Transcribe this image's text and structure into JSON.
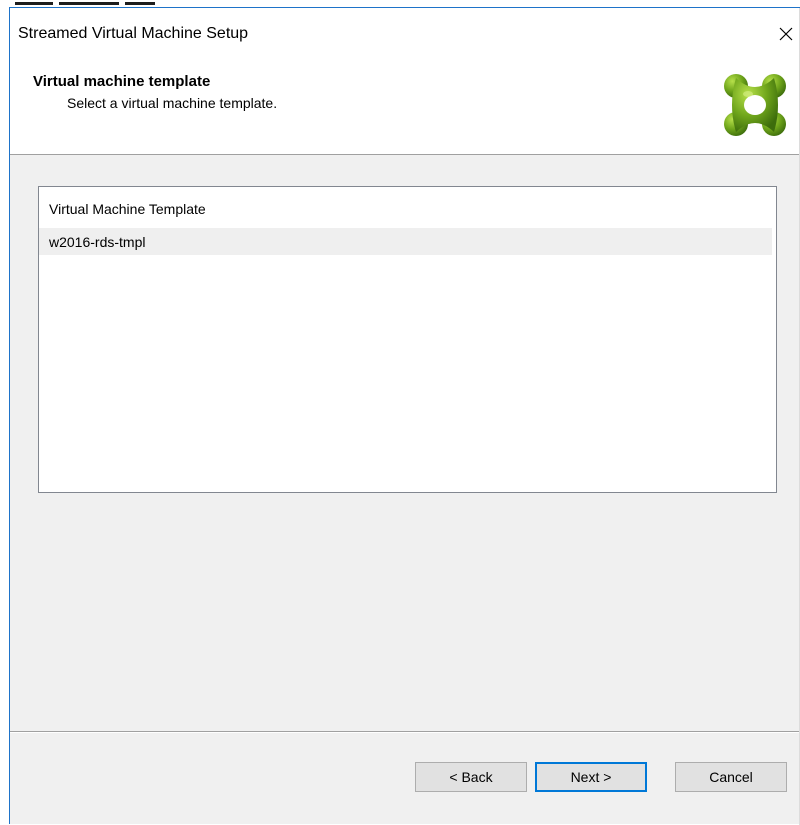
{
  "window": {
    "title": "Streamed Virtual Machine Setup"
  },
  "header": {
    "title": "Virtual machine template",
    "subtitle": "Select a virtual machine template."
  },
  "list": {
    "column_header": "Virtual Machine Template",
    "rows": [
      "w2016-rds-tmpl"
    ]
  },
  "buttons": {
    "back": "< Back",
    "next": "Next >",
    "cancel": "Cancel"
  },
  "icons": {
    "close": "close-icon",
    "logo": "citrix-logo-icon"
  },
  "colors": {
    "accent": "#0078d7",
    "logo_green": "#7cb518"
  }
}
